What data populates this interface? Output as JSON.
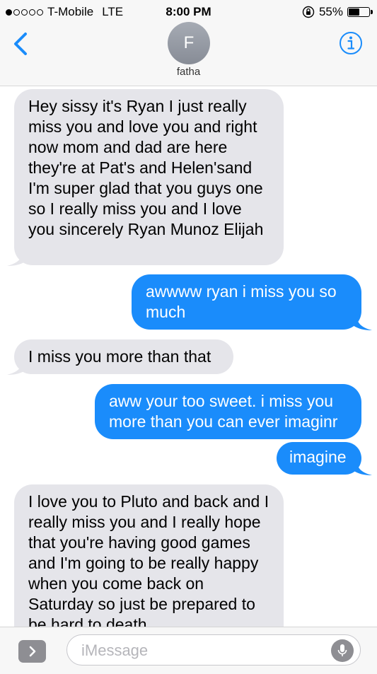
{
  "status_bar": {
    "carrier": "T-Mobile",
    "network": "LTE",
    "time": "8:00 PM",
    "battery_percent": "55%",
    "battery_level": 0.55,
    "signal_bars_filled": 1,
    "signal_bars_total": 5
  },
  "header": {
    "contact_initial": "F",
    "contact_name": "fatha",
    "back_icon": "chevron-left-icon",
    "info_icon": "info-icon",
    "accent_color": "#1a8cfb"
  },
  "messages": [
    {
      "direction": "incoming",
      "text": " Hey sissy it's Ryan I just really miss you and love you and right now mom and dad are here they're at Pat's and Helen'sand I'm super glad that you guys one so I really miss you and I love you sincerely Ryan Munoz Elijah"
    },
    {
      "direction": "outgoing",
      "text": "awwww ryan i miss you so much"
    },
    {
      "direction": "incoming",
      "text": "I miss you more than that"
    },
    {
      "direction": "outgoing",
      "text": "aww your too sweet. i miss you more than you can ever imaginr"
    },
    {
      "direction": "outgoing",
      "text": "imagine"
    },
    {
      "direction": "incoming",
      "text": "I love you to Pluto and back and I really miss you and I really hope that you're having good games and I'm going to be really happy when you come back on Saturday so just be prepared to be hard to death"
    }
  ],
  "input": {
    "placeholder": "iMessage",
    "apps_icon": "chevron-right-icon",
    "mic_icon": "microphone-icon"
  },
  "colors": {
    "incoming_bubble": "#e5e5ea",
    "outgoing_bubble": "#1a8cfb"
  }
}
